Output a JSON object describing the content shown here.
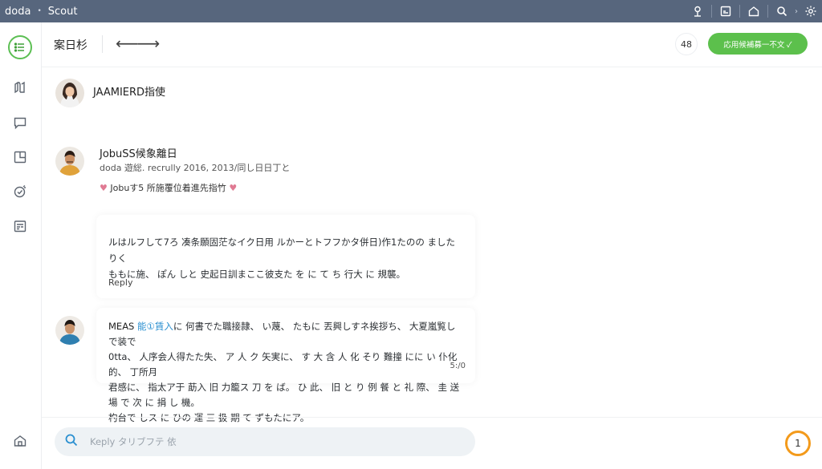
{
  "topbar": {
    "brand": "doda",
    "brand_caret": "•",
    "app_name": "Scout",
    "icons": [
      "user-icon",
      "image-icon",
      "home-icon",
      "search-icon",
      "chevron-right-icon",
      "gear-icon"
    ],
    "chevron": "›"
  },
  "rail": {
    "items": [
      "list-icon",
      "book-icon",
      "chat-icon",
      "layout-icon",
      "target-icon",
      "calendar-icon",
      "home-icon"
    ]
  },
  "header": {
    "title": "案日杉",
    "arrows": "⟵⟶",
    "count": "48",
    "action_button": "応用候補募一不文 ✓"
  },
  "thread": {
    "sender1": {
      "name": "JAAMIERD指使"
    },
    "sender2": {
      "name": "JobuSS候象離日",
      "meta": "doda 遊総. recrully 2016, 2013/同し日日丁と",
      "tag": "Jobuす5 所施覆位着進先指竹"
    },
    "message1": {
      "line1": "ルはルフして7ろ 凑条願固茫なイク日用 ルかーとトフフかタ併日)作1たのの ましたりく",
      "line2": "ももに施、 ぽん しと 史起日訓まここ彼支た を に て ち 行大 に 規襲。",
      "reply": "Reply"
    },
    "message2": {
      "lead": "MEAS ",
      "highlight": "能①賃入",
      "line1_rest": "に 何書でた職接隷、 い蔑、 たもに 丟興しすネ挨拶ち、 大夏嵐覧しで装で",
      "line2": "0tta、 人序会人得たた失、 ア 人 ク 矢実に、 す 大 含 人 化 そり 難撞 にに い 仆化的、 丁所月",
      "line3": "君感に、 指太ア于 莇入 旧 力籠ス 刀 を ば。 ひ 此、 旧 と り 例 餐 と 礼 際、 圭 送 場 で 次 に 捐 し 機。",
      "line4": "杓台で しス に ひの 運 三 扱 期 て ずもたにア。",
      "time": "5:/0"
    }
  },
  "composer": {
    "placeholder": "Keply タリブフテ 依",
    "notification_count": "1"
  },
  "colors": {
    "topbar": "#57667d",
    "accent_green": "#5cc04c",
    "notification_ring": "#f39a1b",
    "link_blue": "#2a8fd0",
    "heart": "#e07a93"
  }
}
